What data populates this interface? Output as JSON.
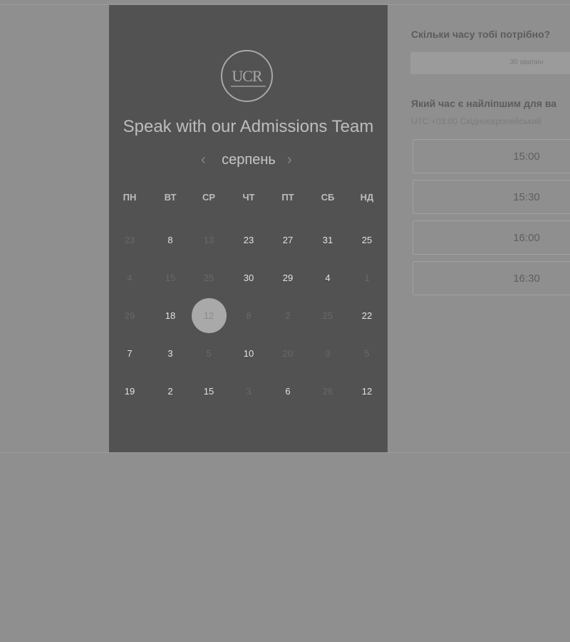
{
  "calendar": {
    "logo_text": "UCR",
    "title": "Speak with our Admissions Team",
    "month": "серпень",
    "prev_icon": "‹",
    "next_icon": "›",
    "weekdays": [
      "ПН",
      "ВТ",
      "СР",
      "ЧТ",
      "ПТ",
      "СБ",
      "НД"
    ],
    "weeks": [
      [
        {
          "t": "23",
          "on": false
        },
        {
          "t": "8",
          "on": true
        },
        {
          "t": "13",
          "on": false
        },
        {
          "t": "23",
          "on": true
        },
        {
          "t": "27",
          "on": true
        },
        {
          "t": "31",
          "on": true
        },
        {
          "t": "25",
          "on": true
        }
      ],
      [
        {
          "t": "4",
          "on": false
        },
        {
          "t": "15",
          "on": false
        },
        {
          "t": "25",
          "on": false
        },
        {
          "t": "30",
          "on": true
        },
        {
          "t": "29",
          "on": true
        },
        {
          "t": "4",
          "on": true
        },
        {
          "t": "1",
          "on": false
        }
      ],
      [
        {
          "t": "29",
          "on": false
        },
        {
          "t": "18",
          "on": true
        },
        {
          "t": "12",
          "on": false,
          "selected": true
        },
        {
          "t": "8",
          "on": false
        },
        {
          "t": "2",
          "on": false
        },
        {
          "t": "25",
          "on": false
        },
        {
          "t": "22",
          "on": true
        }
      ],
      [
        {
          "t": "7",
          "on": true
        },
        {
          "t": "3",
          "on": true
        },
        {
          "t": "5",
          "on": false
        },
        {
          "t": "10",
          "on": true
        },
        {
          "t": "20",
          "on": false
        },
        {
          "t": "3",
          "on": false
        },
        {
          "t": "5",
          "on": false
        }
      ],
      [
        {
          "t": "19",
          "on": true
        },
        {
          "t": "2",
          "on": true
        },
        {
          "t": "15",
          "on": true
        },
        {
          "t": "3",
          "on": false
        },
        {
          "t": "6",
          "on": true
        },
        {
          "t": "26",
          "on": false
        },
        {
          "t": "12",
          "on": true
        }
      ]
    ]
  },
  "form": {
    "duration_question": "Скільки часу тобі потрібно?",
    "duration_value": "30 хвилин",
    "time_question": "Який час є найліпшим для ва",
    "timezone": "UTC +03:00 Східноєвропейський",
    "slots": [
      "15:00",
      "15:30",
      "16:00",
      "16:30"
    ]
  }
}
